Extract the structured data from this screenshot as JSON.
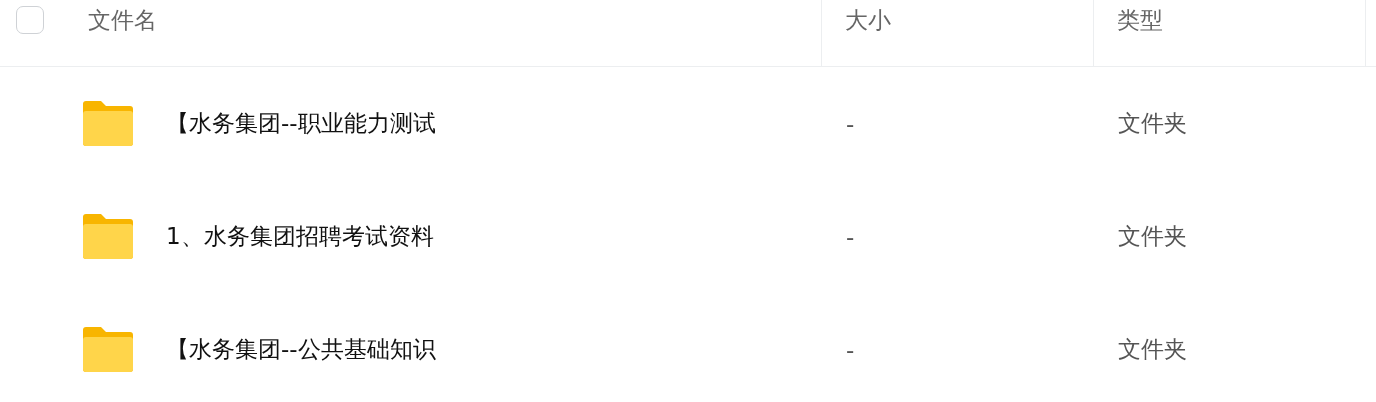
{
  "table": {
    "select_all": {
      "checked": false
    },
    "columns": [
      "文件名",
      "大小",
      "类型"
    ],
    "rows": [
      {
        "name": "【水务集团--职业能力测试",
        "size": "-",
        "type": "文件夹"
      },
      {
        "name": "1、水务集团招聘考试资料",
        "size": "-",
        "type": "文件夹"
      },
      {
        "name": "【水务集团--公共基础知识",
        "size": "-",
        "type": "文件夹"
      }
    ]
  }
}
